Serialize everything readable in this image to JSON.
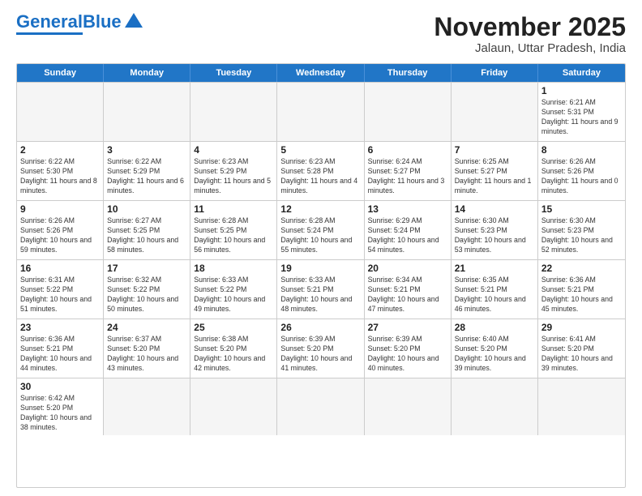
{
  "logo": {
    "text1": "General",
    "text2": "Blue"
  },
  "title": "November 2025",
  "subtitle": "Jalaun, Uttar Pradesh, India",
  "weekdays": [
    "Sunday",
    "Monday",
    "Tuesday",
    "Wednesday",
    "Thursday",
    "Friday",
    "Saturday"
  ],
  "weeks": [
    [
      {
        "day": "",
        "info": "",
        "empty": true
      },
      {
        "day": "",
        "info": "",
        "empty": true
      },
      {
        "day": "",
        "info": "",
        "empty": true
      },
      {
        "day": "",
        "info": "",
        "empty": true
      },
      {
        "day": "",
        "info": "",
        "empty": true
      },
      {
        "day": "",
        "info": "",
        "empty": true
      },
      {
        "day": "1",
        "info": "Sunrise: 6:21 AM\nSunset: 5:31 PM\nDaylight: 11 hours and 9 minutes."
      }
    ],
    [
      {
        "day": "2",
        "info": "Sunrise: 6:22 AM\nSunset: 5:30 PM\nDaylight: 11 hours and 8 minutes."
      },
      {
        "day": "3",
        "info": "Sunrise: 6:22 AM\nSunset: 5:29 PM\nDaylight: 11 hours and 6 minutes."
      },
      {
        "day": "4",
        "info": "Sunrise: 6:23 AM\nSunset: 5:29 PM\nDaylight: 11 hours and 5 minutes."
      },
      {
        "day": "5",
        "info": "Sunrise: 6:23 AM\nSunset: 5:28 PM\nDaylight: 11 hours and 4 minutes."
      },
      {
        "day": "6",
        "info": "Sunrise: 6:24 AM\nSunset: 5:27 PM\nDaylight: 11 hours and 3 minutes."
      },
      {
        "day": "7",
        "info": "Sunrise: 6:25 AM\nSunset: 5:27 PM\nDaylight: 11 hours and 1 minute."
      },
      {
        "day": "8",
        "info": "Sunrise: 6:26 AM\nSunset: 5:26 PM\nDaylight: 11 hours and 0 minutes."
      }
    ],
    [
      {
        "day": "9",
        "info": "Sunrise: 6:26 AM\nSunset: 5:26 PM\nDaylight: 10 hours and 59 minutes."
      },
      {
        "day": "10",
        "info": "Sunrise: 6:27 AM\nSunset: 5:25 PM\nDaylight: 10 hours and 58 minutes."
      },
      {
        "day": "11",
        "info": "Sunrise: 6:28 AM\nSunset: 5:25 PM\nDaylight: 10 hours and 56 minutes."
      },
      {
        "day": "12",
        "info": "Sunrise: 6:28 AM\nSunset: 5:24 PM\nDaylight: 10 hours and 55 minutes."
      },
      {
        "day": "13",
        "info": "Sunrise: 6:29 AM\nSunset: 5:24 PM\nDaylight: 10 hours and 54 minutes."
      },
      {
        "day": "14",
        "info": "Sunrise: 6:30 AM\nSunset: 5:23 PM\nDaylight: 10 hours and 53 minutes."
      },
      {
        "day": "15",
        "info": "Sunrise: 6:30 AM\nSunset: 5:23 PM\nDaylight: 10 hours and 52 minutes."
      }
    ],
    [
      {
        "day": "16",
        "info": "Sunrise: 6:31 AM\nSunset: 5:22 PM\nDaylight: 10 hours and 51 minutes."
      },
      {
        "day": "17",
        "info": "Sunrise: 6:32 AM\nSunset: 5:22 PM\nDaylight: 10 hours and 50 minutes."
      },
      {
        "day": "18",
        "info": "Sunrise: 6:33 AM\nSunset: 5:22 PM\nDaylight: 10 hours and 49 minutes."
      },
      {
        "day": "19",
        "info": "Sunrise: 6:33 AM\nSunset: 5:21 PM\nDaylight: 10 hours and 48 minutes."
      },
      {
        "day": "20",
        "info": "Sunrise: 6:34 AM\nSunset: 5:21 PM\nDaylight: 10 hours and 47 minutes."
      },
      {
        "day": "21",
        "info": "Sunrise: 6:35 AM\nSunset: 5:21 PM\nDaylight: 10 hours and 46 minutes."
      },
      {
        "day": "22",
        "info": "Sunrise: 6:36 AM\nSunset: 5:21 PM\nDaylight: 10 hours and 45 minutes."
      }
    ],
    [
      {
        "day": "23",
        "info": "Sunrise: 6:36 AM\nSunset: 5:21 PM\nDaylight: 10 hours and 44 minutes."
      },
      {
        "day": "24",
        "info": "Sunrise: 6:37 AM\nSunset: 5:20 PM\nDaylight: 10 hours and 43 minutes."
      },
      {
        "day": "25",
        "info": "Sunrise: 6:38 AM\nSunset: 5:20 PM\nDaylight: 10 hours and 42 minutes."
      },
      {
        "day": "26",
        "info": "Sunrise: 6:39 AM\nSunset: 5:20 PM\nDaylight: 10 hours and 41 minutes."
      },
      {
        "day": "27",
        "info": "Sunrise: 6:39 AM\nSunset: 5:20 PM\nDaylight: 10 hours and 40 minutes."
      },
      {
        "day": "28",
        "info": "Sunrise: 6:40 AM\nSunset: 5:20 PM\nDaylight: 10 hours and 39 minutes."
      },
      {
        "day": "29",
        "info": "Sunrise: 6:41 AM\nSunset: 5:20 PM\nDaylight: 10 hours and 39 minutes."
      }
    ],
    [
      {
        "day": "30",
        "info": "Sunrise: 6:42 AM\nSunset: 5:20 PM\nDaylight: 10 hours and 38 minutes."
      },
      {
        "day": "",
        "info": "",
        "empty": true
      },
      {
        "day": "",
        "info": "",
        "empty": true
      },
      {
        "day": "",
        "info": "",
        "empty": true
      },
      {
        "day": "",
        "info": "",
        "empty": true
      },
      {
        "day": "",
        "info": "",
        "empty": true
      },
      {
        "day": "",
        "info": "",
        "empty": true
      }
    ]
  ]
}
